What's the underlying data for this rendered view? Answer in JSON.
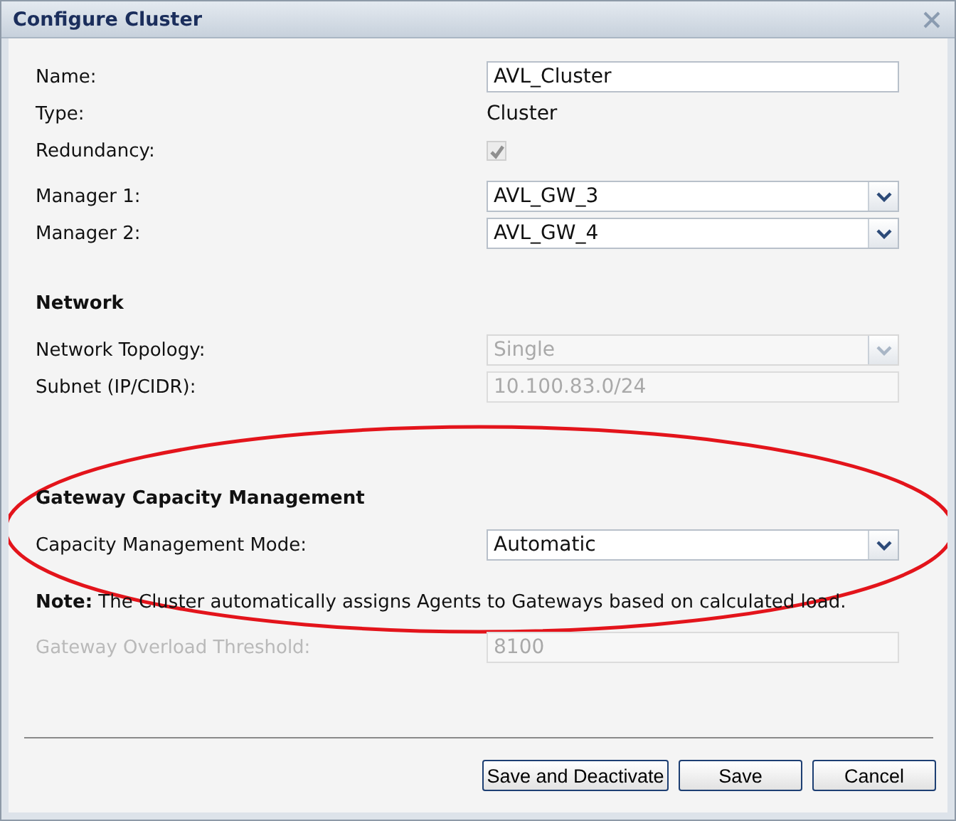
{
  "window": {
    "title": "Configure Cluster"
  },
  "sections": [
    {
      "rows": [
        {
          "kind": "text",
          "label": "Name:",
          "value": "AVL_Cluster"
        },
        {
          "kind": "static",
          "label": "Type:",
          "value": "Cluster"
        },
        {
          "kind": "checkbox",
          "label": "Redundancy:",
          "checked": true,
          "disabled": true
        },
        {
          "kind": "select",
          "label": "Manager 1:",
          "value": "AVL_GW_3"
        },
        {
          "kind": "select",
          "label": "Manager 2:",
          "value": "AVL_GW_4"
        }
      ]
    },
    {
      "heading": "Network",
      "rows": [
        {
          "kind": "select",
          "label": "Network Topology:",
          "value": "Single",
          "disabled": true
        },
        {
          "kind": "text",
          "label": "Subnet (IP/CIDR):",
          "value": "10.100.83.0/24",
          "disabled": true
        }
      ]
    },
    {
      "heading": "Gateway Capacity Management",
      "rows": [
        {
          "kind": "select",
          "label": "Capacity Management Mode:",
          "value": "Automatic"
        },
        {
          "kind": "note",
          "text": "**Note:** The Cluster automatically assigns Agents to Gateways based on calculated load."
        },
        {
          "kind": "text",
          "label": "Gateway Overload Threshold:",
          "value": "8100",
          "disabled": true,
          "label_disabled": true
        }
      ]
    }
  ],
  "buttons": [
    "Save and Deactivate",
    "Save",
    "Cancel"
  ]
}
